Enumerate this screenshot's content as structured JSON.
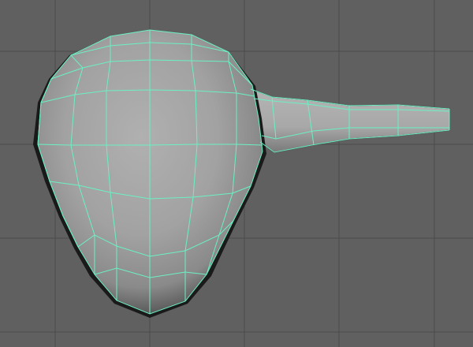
{
  "viewport": {
    "view_name": "perspective-viewport",
    "background_color": "#606060",
    "grid_color": "#4a4a4a",
    "wire_color": "#6bf0c4"
  },
  "scene": {
    "object": "polygon-mesh",
    "selection_state": "selected",
    "parts": [
      "head",
      "stem"
    ]
  }
}
